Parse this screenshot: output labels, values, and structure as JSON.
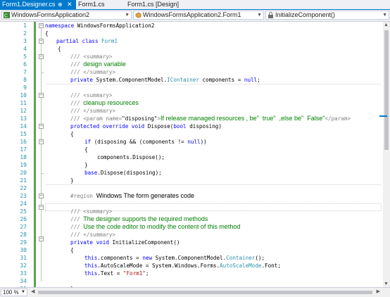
{
  "tabs": [
    {
      "label": "Form1.Designer.cs",
      "active": true
    },
    {
      "label": "Form1.cs",
      "active": false
    },
    {
      "label": "Form1.cs [Design]",
      "active": false
    }
  ],
  "navbar": {
    "project": "WindowsFormsApplication2",
    "class": "WindowsFormsApplication2.Form1",
    "member": "InitializeComponent()"
  },
  "editor": {
    "line_numbers": [
      "1",
      "2",
      "3",
      "4",
      "5",
      "6",
      "7",
      "8",
      "9",
      "10",
      "11",
      "12",
      "13",
      "14",
      "15",
      "16",
      "17",
      "18",
      "19",
      "20",
      "21",
      "22",
      "23",
      "24",
      "25",
      "26",
      "27",
      "28",
      "29",
      "30",
      "31",
      "32",
      "33",
      "34",
      "35"
    ],
    "code": {
      "l1": {
        "kw": "namespace",
        "rest": " WindowsFormsApplication2"
      },
      "l2": "{",
      "l3": {
        "kw1": "partial",
        "kw2": "class",
        "name": "Form1"
      },
      "l4": "{",
      "l5": {
        "slash": "/// ",
        "tag": "<summary>"
      },
      "l6": {
        "slash": "/// ",
        "text": "design variable"
      },
      "l7": {
        "slash": "/// ",
        "tag": "</summary>"
      },
      "l8": {
        "kw": "private",
        "ns": " System.ComponentModel.",
        "type": "IContainer",
        "mid": " components = ",
        "null": "null",
        "end": ";"
      },
      "l10": {
        "slash": "/// ",
        "tag": "<summary>"
      },
      "l11": {
        "slash": "/// ",
        "text": "cleanup resoureces"
      },
      "l12": {
        "slash": "/// ",
        "tag": "</summary>"
      },
      "l13": {
        "slash": "/// ",
        "tag_open": "<param name=",
        "attr": "\"disposing\"",
        "gt": ">",
        "text": "If release managed resources , be\"  true\"  ,else be\"  False\"",
        "tag_close": "</param>"
      },
      "l14": {
        "kw1": "protected",
        "kw2": "override",
        "kw3": "void",
        "mid": " Dispose(",
        "kw4": "bool",
        "end": " disposing)"
      },
      "l15": "{",
      "l16": {
        "kw": "if",
        "a": " (disposing && (components != ",
        "null": "null",
        "b": "))"
      },
      "l17": "{",
      "l18": "components.Dispose();",
      "l19": "}",
      "l20": {
        "kw": "base",
        "rest": ".Dispose(disposing);"
      },
      "l21": "}",
      "l23": {
        "region": "#region",
        "space": " ",
        "text": "Windows The form generates code"
      },
      "l25": {
        "slash": "/// ",
        "tag": "<summary>"
      },
      "l26": {
        "slash": "/// ",
        "text": "The designer supports the required methods"
      },
      "l27": {
        "slash": "/// ",
        "text": "Use the code editor to modify the content of this method"
      },
      "l28": {
        "slash": "/// ",
        "tag": "</summary>"
      },
      "l29": {
        "kw1": "private",
        "kw2": "void",
        "rest": " InitializeComponent()"
      },
      "l30": "{",
      "l31": {
        "this": "this",
        "a": ".components = ",
        "new": "new",
        "b": " System.ComponentModel.",
        "type": "Container",
        "c": "();"
      },
      "l32": {
        "this": "this",
        "a": ".AutoScaleMode = System.Windows.Forms.",
        "type": "AutoScaleMode",
        "b": ".Font;"
      },
      "l33": {
        "this": "this",
        "a": ".Text = ",
        "str": "\"Form1\"",
        "b": ";"
      },
      "l35": "}"
    }
  },
  "statusbar": {
    "zoom": "100 %"
  },
  "colors": {
    "accent": "#007acc",
    "keyword": "#0000ff",
    "type": "#2b91af",
    "comment": "#008000",
    "string": "#a31515"
  }
}
